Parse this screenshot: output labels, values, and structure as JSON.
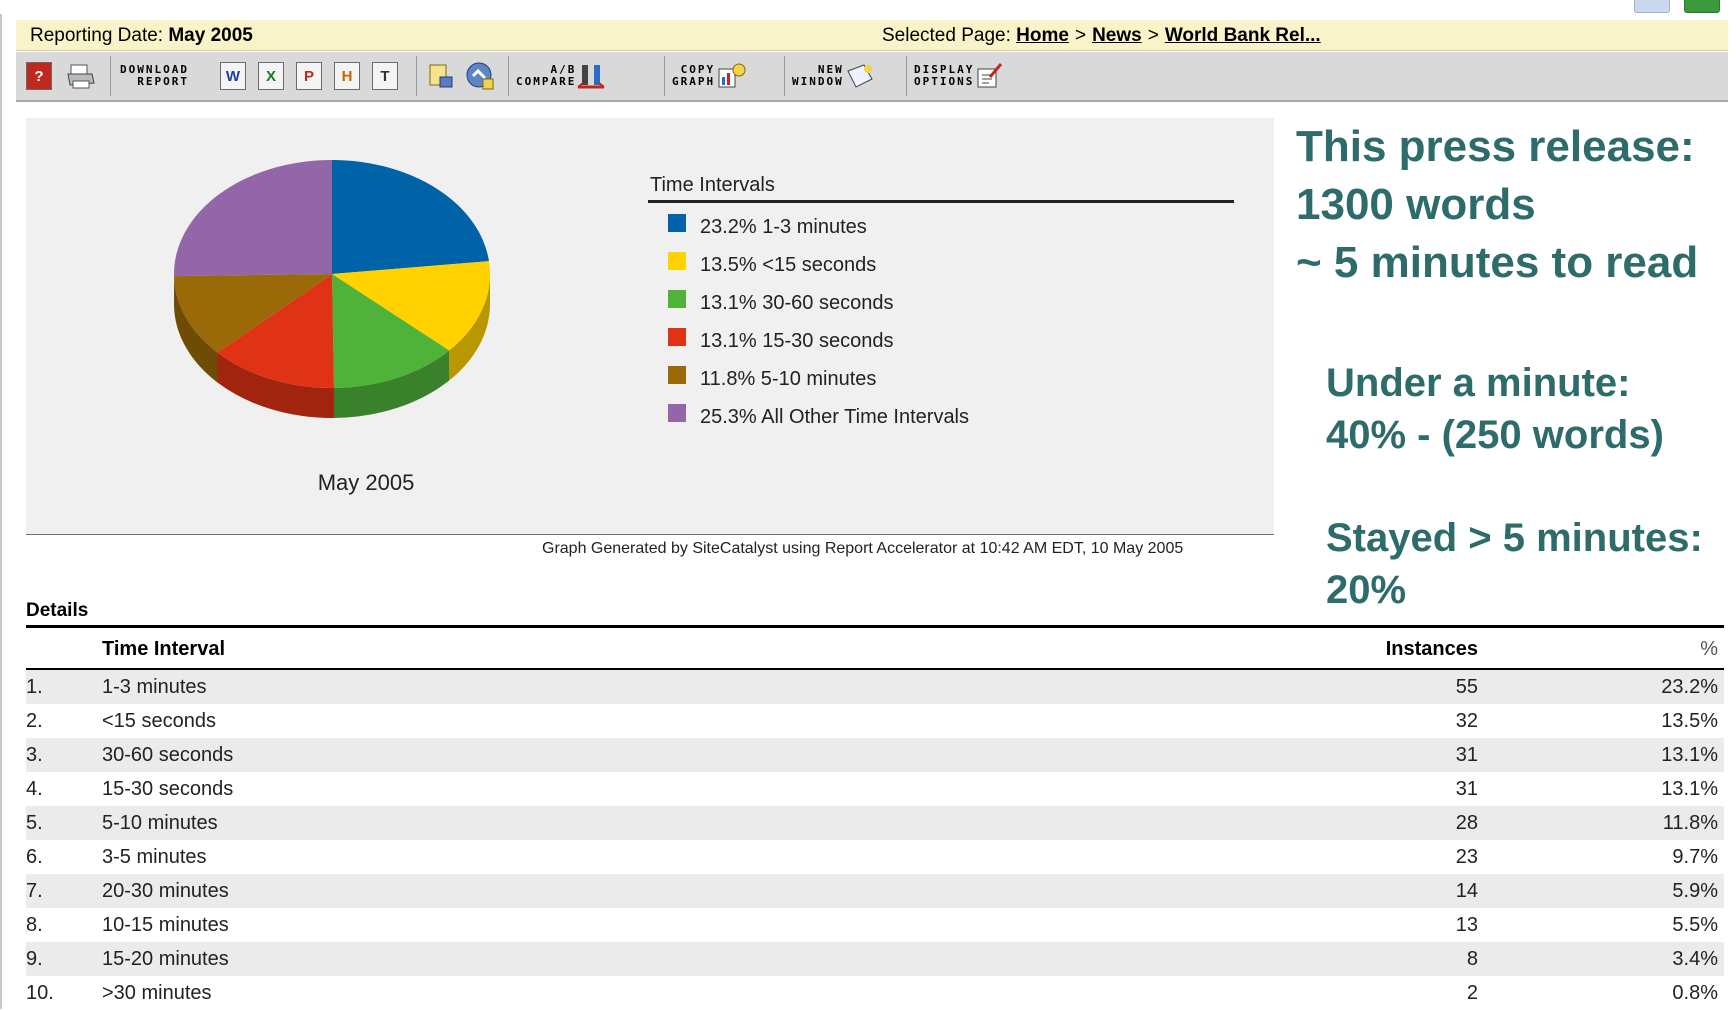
{
  "info": {
    "reporting_prefix": "Reporting Date: ",
    "reporting_date": "May 2005",
    "selected_prefix": "Selected Page: ",
    "breadcrumb": [
      "Home",
      "News",
      "World Bank Rel..."
    ],
    "breadcrumb_sep": ">"
  },
  "toolbar": {
    "download_label": "DOWNLOAD\n  REPORT",
    "compare_label": "  A/B\nCOMPARE",
    "copy_label": " COPY\nGRAPH",
    "new_window_label": "   NEW\nWINDOW",
    "display_label": "DISPLAY\nOPTIONS",
    "icons": [
      "help-icon",
      "print-icon",
      "word-icon",
      "excel-icon",
      "pdf-icon",
      "html-icon",
      "text-icon",
      "bookmark-icon",
      "refresh-icon",
      "compare-icon",
      "copy-graph-icon",
      "new-window-icon",
      "display-options-icon"
    ]
  },
  "chart_data": {
    "type": "pie",
    "caption": "May 2005",
    "legend_title": "Time Intervals",
    "categories": [
      "1-3 minutes",
      "<15 seconds",
      "30-60 seconds",
      "15-30 seconds",
      "5-10 minutes",
      "All Other Time Intervals"
    ],
    "values": [
      23.2,
      13.5,
      13.1,
      13.1,
      11.8,
      25.3
    ],
    "colors": [
      "#0063a8",
      "#ffd200",
      "#4fb33a",
      "#e03214",
      "#9a6a08",
      "#9266a8"
    ],
    "legend_labels": [
      "23.2% 1-3 minutes",
      "13.5% <15 seconds",
      "13.1% 30-60 seconds",
      "13.1% 15-30 seconds",
      "11.8% 5-10 minutes",
      "25.3% All Other Time Intervals"
    ]
  },
  "footnote": "Graph Generated by SiteCatalyst using Report Accelerator at 10:42 AM EDT, 10 May 2005",
  "annotations": {
    "a1": [
      "This press release:",
      "1300 words",
      "~ 5 minutes to read"
    ],
    "a2": [
      "Under a minute:",
      "40% - (250 words)"
    ],
    "a3": [
      "Stayed > 5 minutes:",
      "20%"
    ]
  },
  "details": {
    "label": "Details",
    "col_interval": "Time Interval",
    "col_instances": "Instances",
    "col_pct": "%",
    "rows": [
      {
        "n": "1.",
        "interval": "1-3 minutes",
        "instances": "55",
        "pct": "23.2%"
      },
      {
        "n": "2.",
        "interval": "<15 seconds",
        "instances": "32",
        "pct": "13.5%"
      },
      {
        "n": "3.",
        "interval": "30-60 seconds",
        "instances": "31",
        "pct": "13.1%"
      },
      {
        "n": "4.",
        "interval": "15-30 seconds",
        "instances": "31",
        "pct": "13.1%"
      },
      {
        "n": "5.",
        "interval": "5-10 minutes",
        "instances": "28",
        "pct": "11.8%"
      },
      {
        "n": "6.",
        "interval": "3-5 minutes",
        "instances": "23",
        "pct": "9.7%"
      },
      {
        "n": "7.",
        "interval": "20-30 minutes",
        "instances": "14",
        "pct": "5.9%"
      },
      {
        "n": "8.",
        "interval": "10-15 minutes",
        "instances": "13",
        "pct": "5.5%"
      },
      {
        "n": "9.",
        "interval": "15-20 minutes",
        "instances": "8",
        "pct": "3.4%"
      },
      {
        "n": "10.",
        "interval": ">30 minutes",
        "instances": "2",
        "pct": "0.8%"
      }
    ]
  }
}
